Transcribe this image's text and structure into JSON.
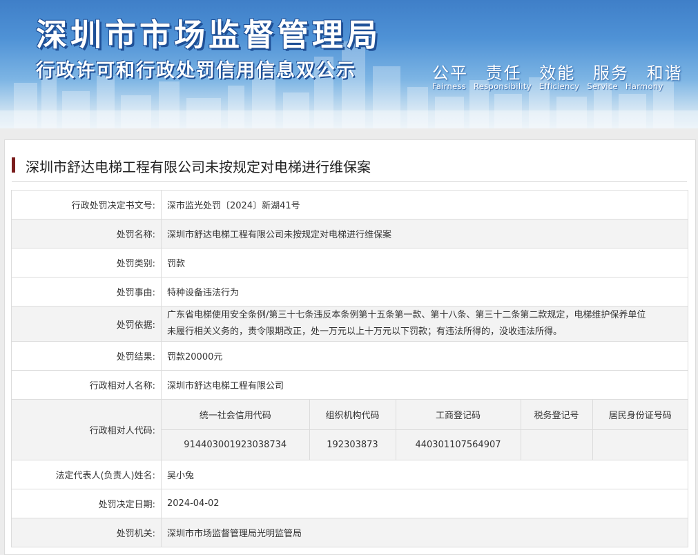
{
  "banner": {
    "title": "深圳市市场监督管理局",
    "subtitle": "行政许可和行政处罚信用信息双公示",
    "values_cn": [
      "公平",
      "责任",
      "效能",
      "服务",
      "和谐"
    ],
    "values_en": [
      "Fairness",
      "Responsibility",
      "Efficiency",
      "Service",
      "Harmony"
    ]
  },
  "page": {
    "heading": "深圳市舒达电梯工程有限公司未按规定对电梯进行维保案"
  },
  "rows": [
    {
      "label": "行政处罚决定书文号:",
      "value": "深市监光处罚〔2024〕新湖41号"
    },
    {
      "label": "处罚名称:",
      "value": "深圳市舒达电梯工程有限公司未按规定对电梯进行维保案"
    },
    {
      "label": "处罚类别:",
      "value": "罚款"
    },
    {
      "label": "处罚事由:",
      "value": "特种设备违法行为"
    },
    {
      "label": "处罚依据:",
      "value_line1": "广东省电梯使用安全条例/第三十七条违反本条例第十五条第一款、第十八条、第三十二条第二款规定，电梯维护保养单位",
      "value_line2": "未履行相关义务的，责令限期改正，处一万元以上十万元以下罚款；有违法所得的，没收违法所得。"
    },
    {
      "label": "处罚结果:",
      "value": "罚款20000元"
    },
    {
      "label": "行政相对人名称:",
      "value": "深圳市舒达电梯工程有限公司"
    },
    {
      "label": "行政相对人代码:"
    },
    {
      "label": "法定代表人(负责人)姓名:",
      "value": "吴小兔"
    },
    {
      "label": "处罚决定日期:",
      "value": "2024-04-02"
    },
    {
      "label": "处罚机关:",
      "value": "深圳市市场监督管理局光明监管局"
    }
  ],
  "codes": {
    "headers": [
      "统一社会信用代码",
      "组织机构代码",
      "工商登记码",
      "税务登记号",
      "居民身份证号码"
    ],
    "values": [
      "914403001923038734",
      "192303873",
      "440301107564907",
      "",
      ""
    ]
  },
  "colors": {
    "banner_blue": "#4f92d6",
    "heading_bar": "#7a1d1d",
    "row_alt": "#f3f3f3",
    "border": "#dcdcdc"
  }
}
